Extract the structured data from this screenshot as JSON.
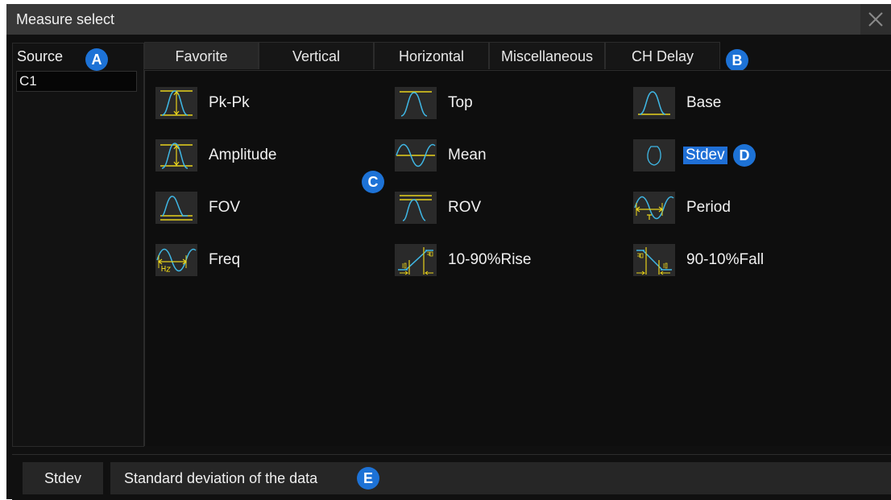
{
  "dialog": {
    "title": "Measure select",
    "close_icon": "close-icon"
  },
  "source": {
    "label": "Source",
    "selected": "C1"
  },
  "tabs": [
    {
      "label": "Favorite",
      "active": true
    },
    {
      "label": "Vertical",
      "active": false
    },
    {
      "label": "Horizontal",
      "active": false
    },
    {
      "label": "Miscellaneous",
      "active": false
    },
    {
      "label": "CH Delay",
      "active": false
    }
  ],
  "measurements": [
    {
      "label": "Pk-Pk",
      "icon": "pk-pk-icon",
      "selected": false
    },
    {
      "label": "Top",
      "icon": "top-icon",
      "selected": false
    },
    {
      "label": "Base",
      "icon": "base-icon",
      "selected": false
    },
    {
      "label": "Amplitude",
      "icon": "amplitude-icon",
      "selected": false
    },
    {
      "label": "Mean",
      "icon": "mean-icon",
      "selected": false
    },
    {
      "label": "Stdev",
      "icon": "stdev-icon",
      "selected": true
    },
    {
      "label": "FOV",
      "icon": "fov-icon",
      "selected": false
    },
    {
      "label": "ROV",
      "icon": "rov-icon",
      "selected": false
    },
    {
      "label": "Period",
      "icon": "period-icon",
      "selected": false
    },
    {
      "label": "Freq",
      "icon": "freq-icon",
      "selected": false
    },
    {
      "label": "10-90%Rise",
      "icon": "rise-icon",
      "selected": false
    },
    {
      "label": "90-10%Fall",
      "icon": "fall-icon",
      "selected": false
    }
  ],
  "annotations": {
    "a": "A",
    "b": "B",
    "c": "C",
    "d": "D",
    "e": "E"
  },
  "bottom": {
    "name": "Stdev",
    "description": "Standard deviation of the data"
  },
  "colors": {
    "background": "#101010",
    "titlebar": "#383838",
    "accent": "#1f6fd6",
    "badge": "#1d72d6",
    "waveform_yellow": "#e8d21c",
    "waveform_cyan": "#3fb8e6"
  }
}
